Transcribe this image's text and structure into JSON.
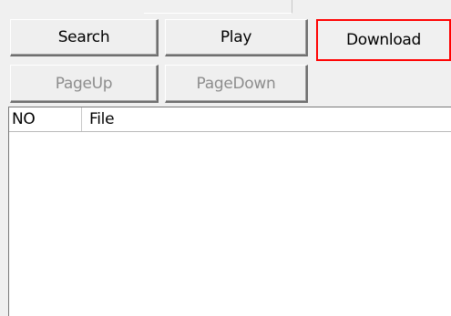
{
  "toolbar": {
    "search_label": "Search",
    "play_label": "Play",
    "download_label": "Download",
    "pageup_label": "PageUp",
    "pagedown_label": "PageDown"
  },
  "list": {
    "columns": [
      "NO",
      "File"
    ],
    "rows": []
  }
}
